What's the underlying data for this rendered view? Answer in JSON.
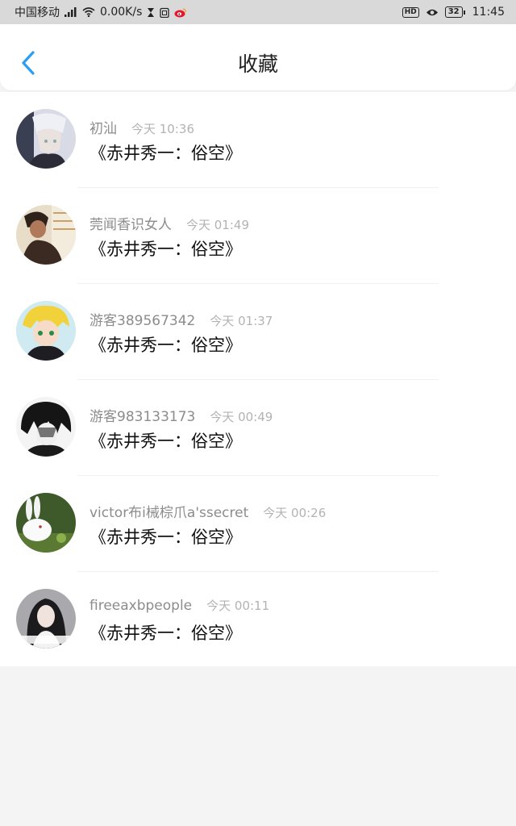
{
  "status_bar": {
    "carrier": "中国移动",
    "net_speed": "0.00K/s",
    "battery": "32",
    "hd": "HD",
    "time": "11:45"
  },
  "header": {
    "title": "收藏",
    "back_icon": "chevron-left-icon"
  },
  "accent_color": "#2a9df4",
  "favorites": [
    {
      "username": "初汕",
      "time": "今天 10:36",
      "content": "《赤井秀一：俗空》"
    },
    {
      "username": "莞闻香识女人",
      "time": "今天 01:49",
      "content": "《赤井秀一：俗空》"
    },
    {
      "username": "游客389567342",
      "time": "今天 01:37",
      "content": "《赤井秀一：俗空》"
    },
    {
      "username": "游客983133173",
      "time": "今天 00:49",
      "content": "《赤井秀一：俗空》"
    },
    {
      "username": "victor布i械棕爪a'ssecret",
      "time": "今天 00:26",
      "content": "《赤井秀一：俗空》"
    },
    {
      "username": "fireeaxbpeople",
      "time": "今天 00:11",
      "content": "《赤井秀一：俗空》"
    }
  ]
}
